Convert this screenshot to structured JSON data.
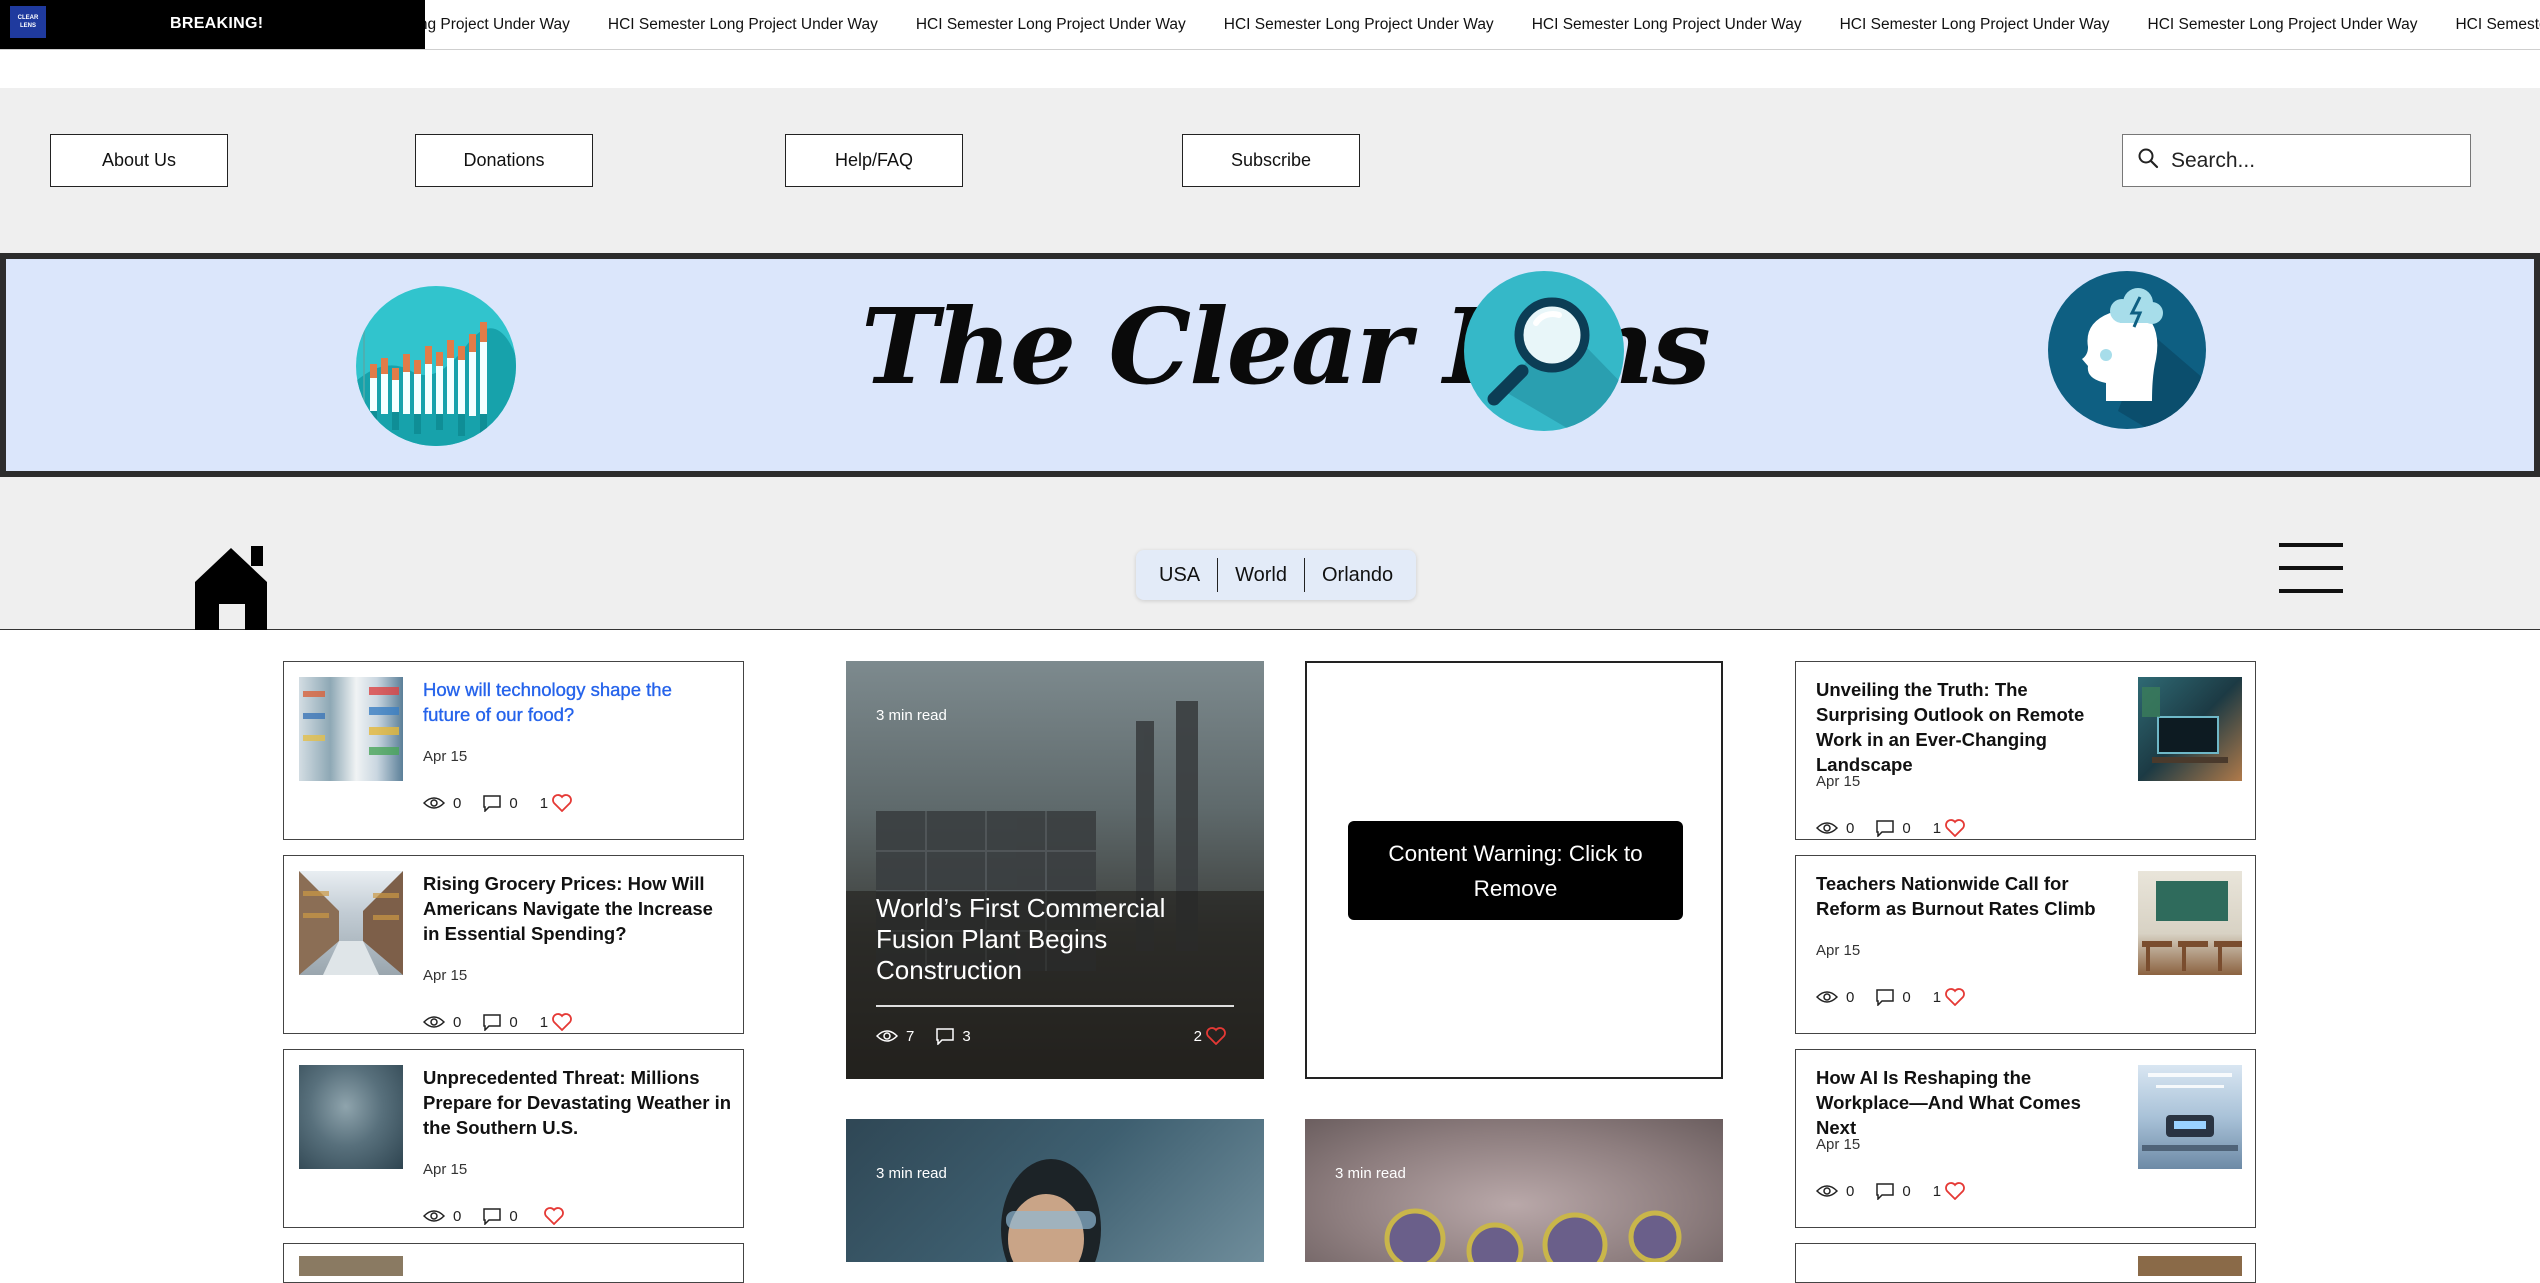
{
  "ticker": {
    "label": "BREAKING!",
    "logo_text": "CLEAR LENS",
    "items": [
      "HCI Semester Long Project Under Way",
      "HCI Semester Long Project Under Way",
      "HCI Semester Long Project Under Way",
      "HCI Semester Long Project Under Way",
      "HCI Semester Long Project Under Way",
      "HCI Semester Long Project Under Way",
      "HCI Semester Long Project Under Way",
      "HCI Semester Long Project Under Way"
    ]
  },
  "nav": {
    "about": "About Us",
    "donations": "Donations",
    "help": "Help/FAQ",
    "subscribe": "Subscribe",
    "search_placeholder": "Search..."
  },
  "banner": {
    "title": "The Clear Lens",
    "icons": [
      "bar-chart-icon",
      "magnifier-icon",
      "thinking-head-icon"
    ]
  },
  "sections": {
    "items": [
      "USA",
      "World",
      "Orlando"
    ]
  },
  "left_posts": [
    {
      "title": "How will technology shape the future of our food?",
      "date": "Apr 15",
      "views": "0",
      "comments": "0",
      "likes": "1"
    },
    {
      "title": "Rising Grocery Prices: How Will Americans Navigate the Increase in Essential Spending?",
      "date": "Apr 15",
      "views": "0",
      "comments": "0",
      "likes": "1"
    },
    {
      "title": "Unprecedented Threat: Millions Prepare for Devastating Weather in the Southern U.S.",
      "date": "Apr 15",
      "views": "0",
      "comments": "0",
      "likes": ""
    }
  ],
  "right_posts": [
    {
      "title": "Unveiling the Truth: The Surprising Outlook on Remote Work in an Ever-Changing Landscape",
      "date": "Apr 15",
      "views": "0",
      "comments": "0",
      "likes": "1"
    },
    {
      "title": "Teachers Nationwide Call for Reform as Burnout Rates Climb",
      "date": "Apr 15",
      "views": "0",
      "comments": "0",
      "likes": "1"
    },
    {
      "title": "How AI Is Reshaping the Workplace—And What Comes Next",
      "date": "Apr 15",
      "views": "0",
      "comments": "0",
      "likes": "1"
    }
  ],
  "featured": {
    "read_time": "3 min read",
    "title": "World’s First Commercial Fusion Plant Begins Construction",
    "views": "7",
    "comments": "3",
    "likes": "2"
  },
  "content_warning": {
    "button": "Content Warning: Click to Remove"
  },
  "lower_cards": [
    {
      "read_time": "3 min read"
    },
    {
      "read_time": "3 min read"
    }
  ],
  "colors": {
    "banner_bg": "#dbe6fb",
    "band_bg": "#efefef",
    "link_blue": "#2563eb",
    "heart_red": "#e53935"
  }
}
